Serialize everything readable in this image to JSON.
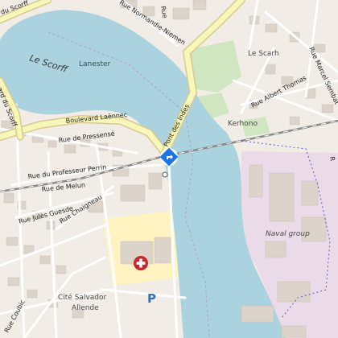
{
  "map": {
    "water_labels": {
      "river": "Le Scorff"
    },
    "place_labels": {
      "lanester": "Lanester",
      "le_scarh": "Le Scarh",
      "kerhono": "Kerhono",
      "naval_group": "Naval group",
      "cite_line1": "Cité Salvador",
      "cite_line2": "Allende"
    },
    "road_labels": {
      "normandie_niemen": "Rue Normandie-Niemen",
      "scorff_top": "du Scorff",
      "bd_scorff_left": "ard du Scorff",
      "bd_laennec": "Boulevard Laënnec",
      "pont_des_indes": "Pont des Indes",
      "rue_pressense": "Rue de Pressensé",
      "rue_perrin": "Rue du Professeur Perrin",
      "rue_melun": "Rue de Melun",
      "rue_chaigneau": "Rue Chaigneau",
      "rue_jules_guesde": "Rue Jules Guesde",
      "rue_albert_thomas": "Rue Albert Thomas",
      "rue_marcel_sembat": "Rue Marcel Sembat",
      "rue_coubic": "Rue Coubic",
      "rue_r_top": "Rue",
      "rue_r_right": "R"
    },
    "markers": {
      "directions": "directions-icon",
      "hospital": "hospital-icon",
      "parking": "P"
    },
    "colors": {
      "water": "#aad3df",
      "land": "#f1ede6",
      "major_road": "#f6f7b8",
      "road_casing": "#d9c98e",
      "industrial": "#ebdbe8",
      "hospital_area": "#fff0b5",
      "park": "#c8e8b8",
      "building": "#d9d0c9",
      "railway": "#8a8a8a",
      "boundary": "#5a5ac8",
      "marker_blue": "#1a73e8",
      "hospital_red": "#c8262b",
      "parking_blue": "#3b6fb6"
    }
  }
}
